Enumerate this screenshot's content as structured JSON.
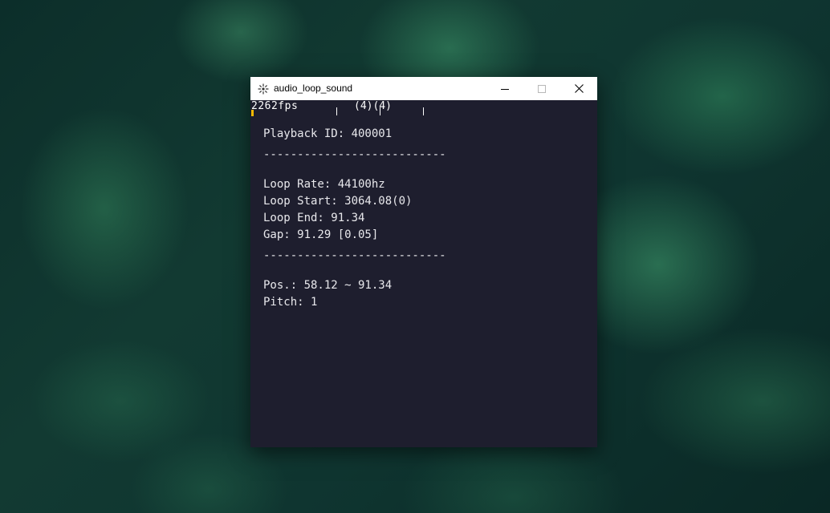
{
  "window": {
    "title": "audio_loop_sound",
    "app_icon": "sparkle-icon",
    "controls": [
      "minimize-icon",
      "maximize-icon",
      "close-icon"
    ]
  },
  "overlay": {
    "fps": "2262fps",
    "counts": "(4)(4)"
  },
  "playback": {
    "id_line": "Playback ID: 400001",
    "separator": "---------------------------",
    "loop_rate": "Loop Rate: 44100hz",
    "loop_start": "Loop Start: 3064.08(0)",
    "loop_end": "Loop End: 91.34",
    "gap": "Gap: 91.29 [0.05]",
    "position": "Pos.: 58.12 ~ 91.34",
    "pitch": "Pitch: 1"
  },
  "colors": {
    "client_bg": "#1e1e2e",
    "text": "#e8e8ec",
    "marker_accent": "#f5b800"
  }
}
